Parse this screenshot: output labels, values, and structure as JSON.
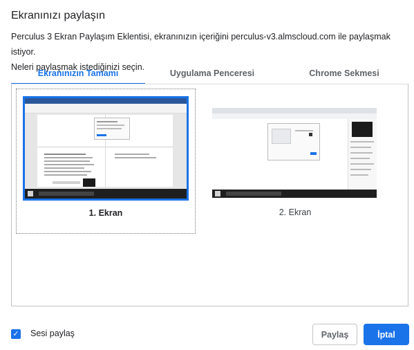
{
  "dialog": {
    "title": "Ekranınızı paylaşın",
    "description_line1": "Perculus 3 Ekran Paylaşım Eklentisi, ekranınızın içeriğini perculus-v3.almscloud.com ile paylaşmak istiyor.",
    "description_line2": "Neleri paylaşmak istediğinizi seçin."
  },
  "tabs": [
    {
      "label": "Ekranınızın Tamamı",
      "active": true
    },
    {
      "label": "Uygulama Penceresi",
      "active": false
    },
    {
      "label": "Chrome Sekmesi",
      "active": false
    }
  ],
  "screens": [
    {
      "label": "1. Ekran",
      "selected": true
    },
    {
      "label": "2. Ekran",
      "selected": false
    }
  ],
  "footer": {
    "share_audio_label": "Sesi paylaş",
    "share_audio_checked": true,
    "share_button": "Paylaş",
    "cancel_button": "İptal"
  },
  "colors": {
    "accent": "#1a73e8",
    "taskbar": "#1f1f1f"
  }
}
